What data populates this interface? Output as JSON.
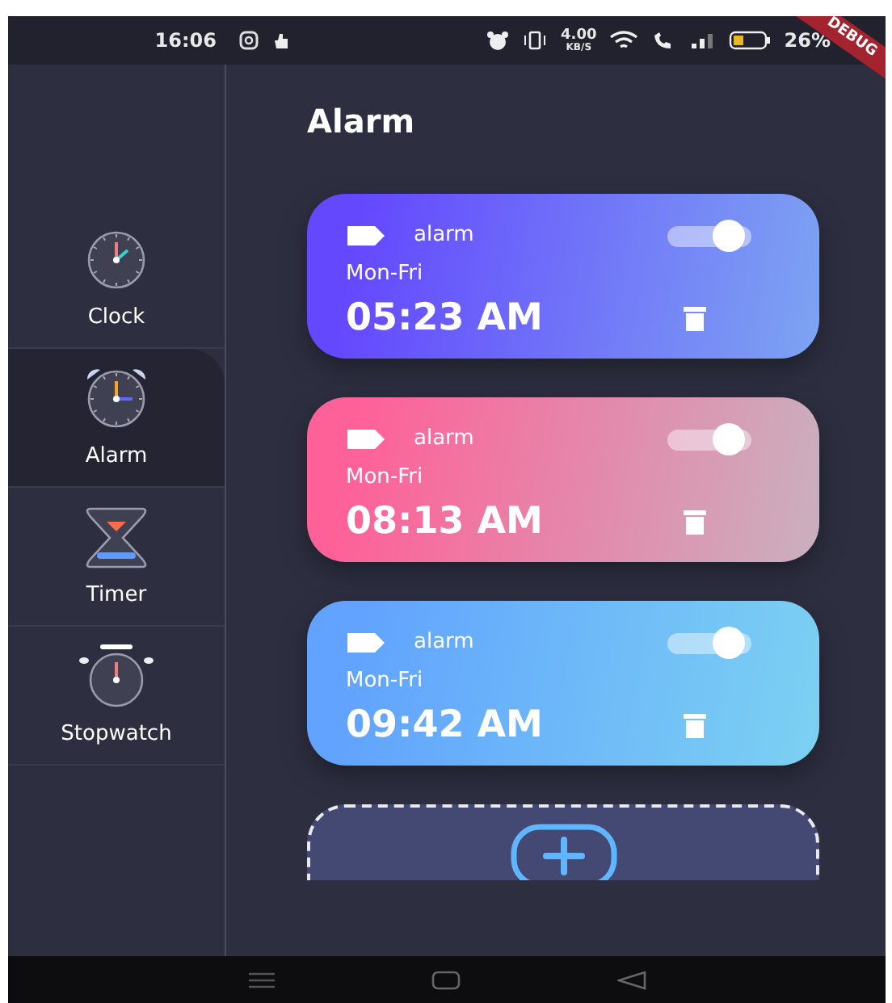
{
  "status_bar": {
    "time": "16:06",
    "network_speed": "4.00",
    "network_unit": "KB/S",
    "battery": "26%",
    "debug_banner": "DEBUG"
  },
  "sidebar": {
    "items": [
      {
        "kind": "clock",
        "label": "Clock",
        "selected": false
      },
      {
        "kind": "alarm",
        "label": "Alarm",
        "selected": true
      },
      {
        "kind": "timer",
        "label": "Timer",
        "selected": false
      },
      {
        "kind": "stopwatch",
        "label": "Stopwatch",
        "selected": false
      }
    ]
  },
  "title": "Alarm",
  "alarms": [
    {
      "label": "alarm",
      "days": "Mon-Fri",
      "time": "05:23 AM",
      "on": true,
      "color": "#6448fe"
    },
    {
      "label": "alarm",
      "days": "Mon-Fri",
      "time": "08:13 AM",
      "on": true,
      "color": "#fe6197"
    },
    {
      "label": "alarm",
      "days": "Mon-Fri",
      "time": "09:42 AM",
      "on": true,
      "color": "#61a3fe"
    }
  ]
}
